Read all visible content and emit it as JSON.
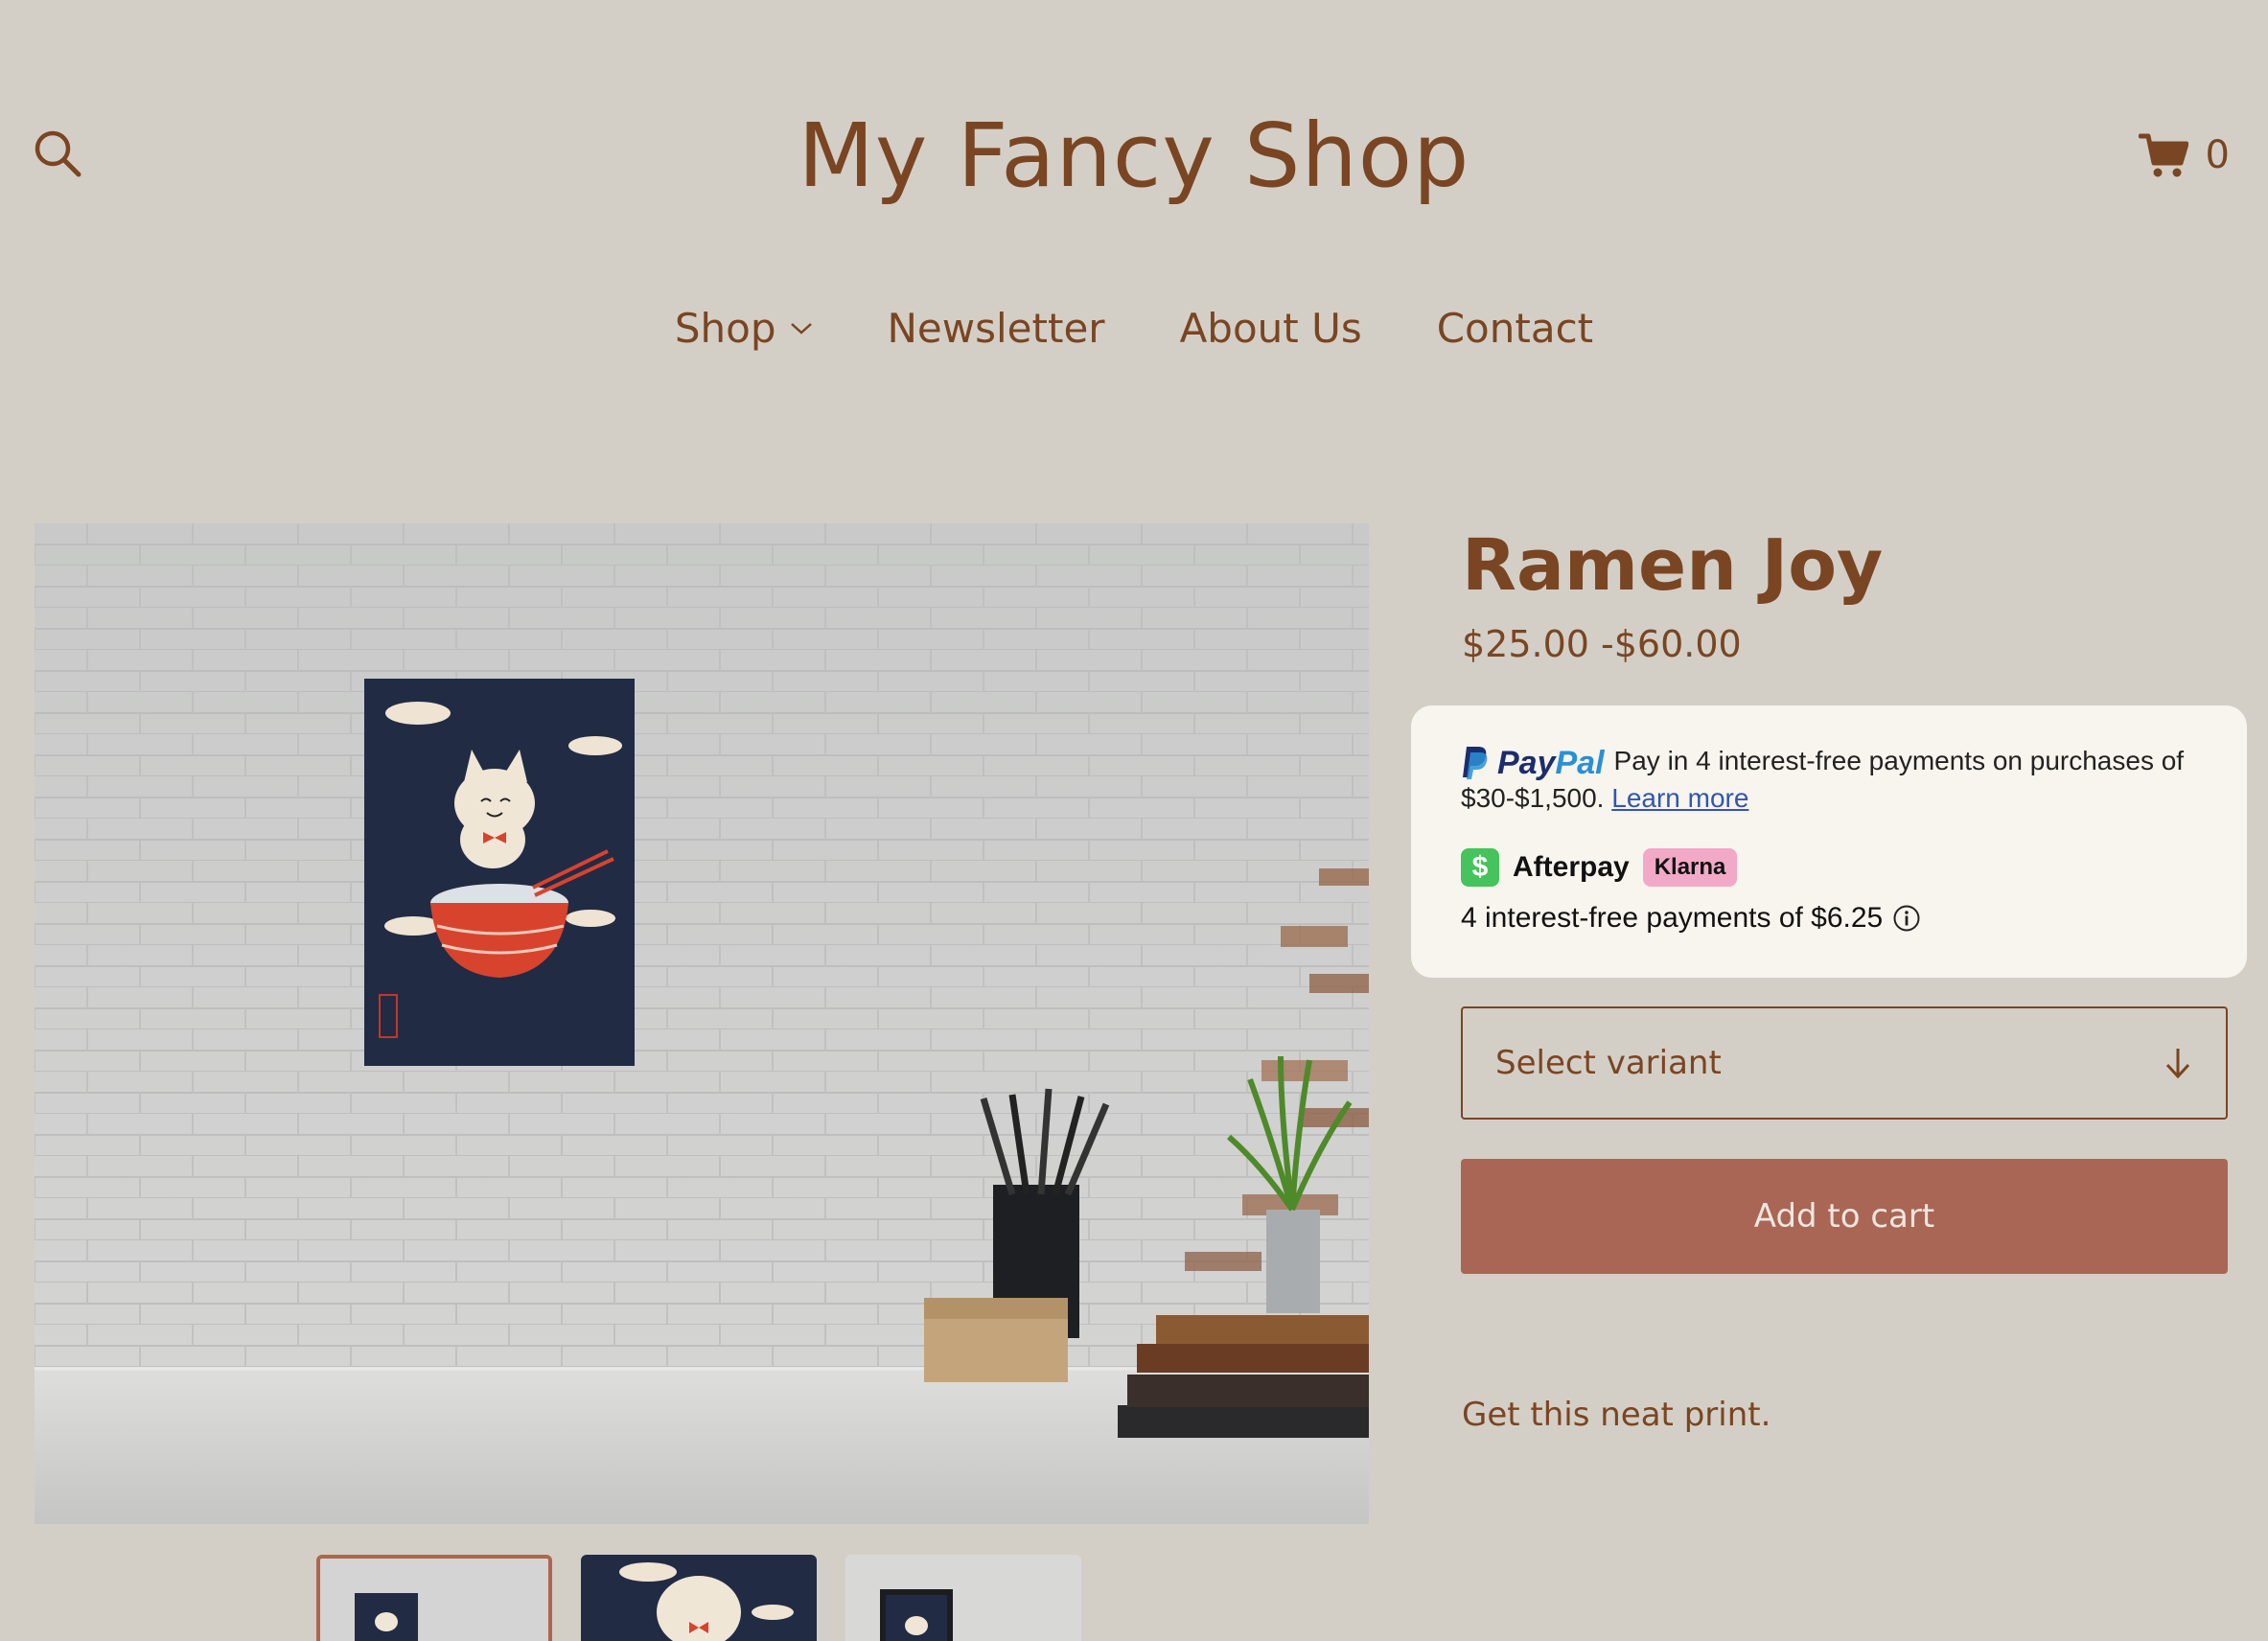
{
  "header": {
    "site_title": "My Fancy Shop",
    "cart_count": "0",
    "search_icon": "search-icon",
    "cart_icon": "cart-icon"
  },
  "nav": {
    "items": [
      {
        "label": "Shop",
        "has_dropdown": true
      },
      {
        "label": "Newsletter"
      },
      {
        "label": "About Us"
      },
      {
        "label": "Contact"
      }
    ]
  },
  "product": {
    "title": "Ramen Joy",
    "price": "$25.00 -$60.00",
    "description": "Get this neat print.",
    "variant_placeholder": "Select variant",
    "add_to_cart_label": "Add to cart",
    "thumbnails": [
      "thumbnail-1",
      "thumbnail-2",
      "thumbnail-3"
    ],
    "selected_thumbnail": 0
  },
  "payments": {
    "paypal_word": "PayPal",
    "paypal_text": "Pay in 4 interest-free payments on purchases of $30-$1,500.",
    "paypal_link": "Learn more",
    "afterpay_label": "Afterpay",
    "afterpay_icon_glyph": "$",
    "klarna_label": "Klarna",
    "installment_text": "4 interest-free payments of $6.25"
  },
  "colors": {
    "background": "#d3cfc7",
    "text_brand": "#7a4522",
    "button": "#a96654",
    "paypal_dark": "#1b2d6b",
    "paypal_light": "#2a90d6",
    "afterpay_green": "#46c35c",
    "klarna_pink": "#f2a9c8"
  }
}
